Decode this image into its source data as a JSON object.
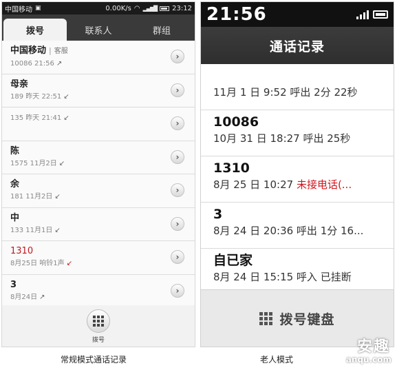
{
  "left": {
    "status": {
      "carrier": "中国移动",
      "speed": "0.00K/s",
      "time": "23:12"
    },
    "tabs": [
      {
        "label": "拨号"
      },
      {
        "label": "联系人"
      },
      {
        "label": "群组"
      }
    ],
    "calls": [
      {
        "name": "中国移动",
        "tag": "客服",
        "detail": "10086 21:56",
        "direction": "outgoing"
      },
      {
        "name": "母亲",
        "detail": "189          昨天 22:51",
        "direction": "incoming"
      },
      {
        "name": "",
        "detail": "135          昨天 21:41",
        "direction": "incoming"
      },
      {
        "name": "陈",
        "detail": "1575          11月2日",
        "direction": "incoming"
      },
      {
        "name": "余",
        "detail": "181          11月2日",
        "direction": "incoming"
      },
      {
        "name": "中",
        "detail": "133          11月1日",
        "direction": "incoming"
      },
      {
        "name": "1310",
        "detail": "8月25日 响铃1声",
        "direction": "missed"
      },
      {
        "name": "3",
        "detail": "8月24日",
        "direction": "outgoing"
      }
    ],
    "dial_label": "拨号"
  },
  "right": {
    "status": {
      "time": "21:56"
    },
    "title": "通话记录",
    "calls": [
      {
        "name": "",
        "detail": "11月 1 日 9:52 呼出 2分 22秒"
      },
      {
        "name": "10086",
        "detail": "10月 31 日 18:27 呼出 25秒"
      },
      {
        "name": "1310",
        "detail": "8月 25 日 10:27 ",
        "missed_text": "未接电话(..."
      },
      {
        "name": "3",
        "detail": "8月 24 日 20:36 呼出 1分 16..."
      },
      {
        "name": "自已家",
        "detail": "8月 24 日 15:15 呼入 已挂断"
      }
    ],
    "dial_label": "拨号键盘"
  },
  "captions": {
    "left": "常规模式通话记录",
    "right": "老人模式"
  },
  "watermark": {
    "big": "安趣",
    "small": "anqu.com"
  },
  "colors": {
    "missed": "#c0181e",
    "tab_bar": "#3a3a3a",
    "title_bar": "#333333"
  }
}
